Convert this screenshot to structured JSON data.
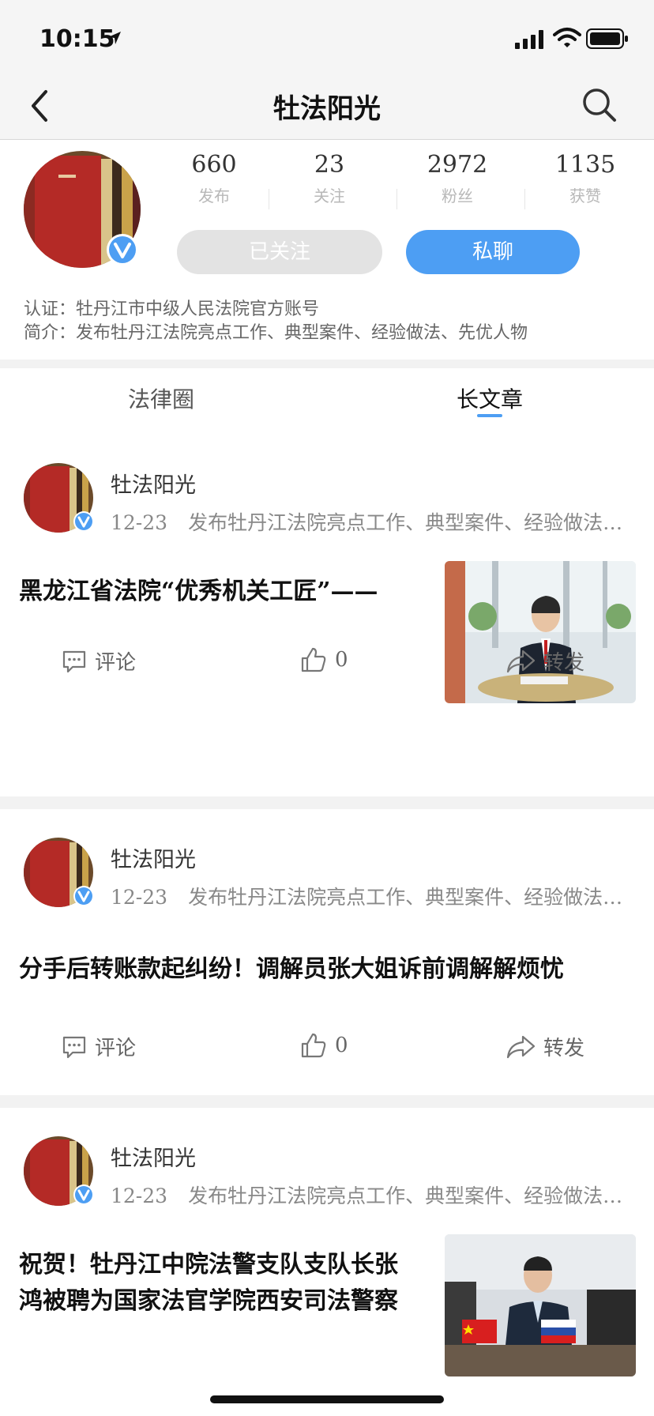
{
  "status_bar": {
    "time": "10:15"
  },
  "nav": {
    "title": "牡法阳光"
  },
  "profile": {
    "stats": [
      {
        "value": "660",
        "label": "发布"
      },
      {
        "value": "23",
        "label": "关注"
      },
      {
        "value": "2972",
        "label": "粉丝"
      },
      {
        "value": "1135",
        "label": "获赞"
      }
    ],
    "follow_button": "已关注",
    "chat_button": "私聊",
    "certification": "认证：牡丹江市中级人民法院官方账号",
    "intro": "简介：发布牡丹江法院亮点工作、典型案件、经验做法、先优人物"
  },
  "tabs": [
    {
      "label": "法律圈",
      "active": false
    },
    {
      "label": "长文章",
      "active": true
    }
  ],
  "posts": [
    {
      "author": "牡法阳光",
      "date": "12-23",
      "excerpt": "发布牡丹江法院亮点工作、典型案件、经验做法…",
      "title": "黑龙江省法院“优秀机关工匠”——",
      "has_image": true,
      "comment_label": "评论",
      "likes": "0",
      "share_label": "转发"
    },
    {
      "author": "牡法阳光",
      "date": "12-23",
      "excerpt": "发布牡丹江法院亮点工作、典型案件、经验做法…",
      "title": "分手后转账款起纠纷！调解员张大姐诉前调解解烦忧",
      "has_image": false,
      "comment_label": "评论",
      "likes": "0",
      "share_label": "转发"
    },
    {
      "author": "牡法阳光",
      "date": "12-23",
      "excerpt": "发布牡丹江法院亮点工作、典型案件、经验做法…",
      "title_lines": [
        "祝贺！牡丹江中院法警支队支队长张",
        "鸿被聘为国家法官学院西安司法警察"
      ],
      "has_image": true
    }
  ],
  "colors": {
    "accent": "#4d9ef3",
    "follow_bg": "#e3e3e3",
    "band": "#f2f2f2"
  }
}
